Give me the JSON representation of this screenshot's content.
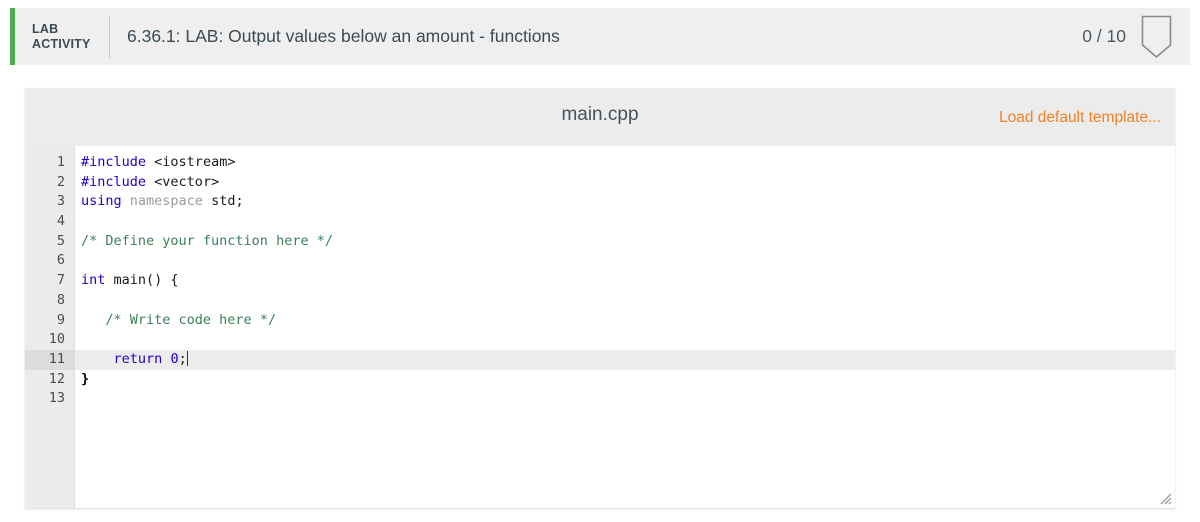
{
  "header": {
    "lab_label": "LAB ACTIVITY",
    "lab_label_line1": "LAB",
    "lab_label_line2": "ACTIVITY",
    "title": "6.36.1: LAB: Output values below an amount - functions",
    "score": "0 / 10",
    "accent_color": "#4caf50",
    "badge_icon": "shield-badge-icon"
  },
  "editor": {
    "filename": "main.cpp",
    "load_template_label": "Load default template...",
    "link_color": "#f08226",
    "active_line": 11,
    "line_numbers": [
      "1",
      "2",
      "3",
      "4",
      "5",
      "6",
      "7",
      "8",
      "9",
      "10",
      "11",
      "12",
      "13"
    ],
    "lines": [
      {
        "n": 1,
        "tokens": [
          {
            "t": "#include",
            "c": "pre"
          },
          {
            "t": " ",
            "c": "plain"
          },
          {
            "t": "<iostream>",
            "c": "plain"
          }
        ]
      },
      {
        "n": 2,
        "tokens": [
          {
            "t": "#include",
            "c": "pre"
          },
          {
            "t": " ",
            "c": "plain"
          },
          {
            "t": "<vector>",
            "c": "plain"
          }
        ]
      },
      {
        "n": 3,
        "tokens": [
          {
            "t": "using",
            "c": "kw"
          },
          {
            "t": " ",
            "c": "plain"
          },
          {
            "t": "namespace",
            "c": "type"
          },
          {
            "t": " std;",
            "c": "plain"
          }
        ]
      },
      {
        "n": 4,
        "tokens": []
      },
      {
        "n": 5,
        "tokens": [
          {
            "t": "/* Define your function here */",
            "c": "cmt"
          }
        ]
      },
      {
        "n": 6,
        "tokens": []
      },
      {
        "n": 7,
        "tokens": [
          {
            "t": "int",
            "c": "kw"
          },
          {
            "t": " main() {",
            "c": "plain"
          }
        ]
      },
      {
        "n": 8,
        "tokens": []
      },
      {
        "n": 9,
        "tokens": [
          {
            "t": "   ",
            "c": "plain"
          },
          {
            "t": "/* Write code here */",
            "c": "cmt"
          }
        ]
      },
      {
        "n": 10,
        "tokens": []
      },
      {
        "n": 11,
        "tokens": [
          {
            "t": "    ",
            "c": "plain"
          },
          {
            "t": "return",
            "c": "kw"
          },
          {
            "t": " ",
            "c": "plain"
          },
          {
            "t": "0",
            "c": "num"
          },
          {
            "t": ";",
            "c": "plain"
          }
        ],
        "caret": true
      },
      {
        "n": 12,
        "tokens": [
          {
            "t": "}",
            "c": "brace"
          }
        ]
      },
      {
        "n": 13,
        "tokens": []
      }
    ]
  }
}
